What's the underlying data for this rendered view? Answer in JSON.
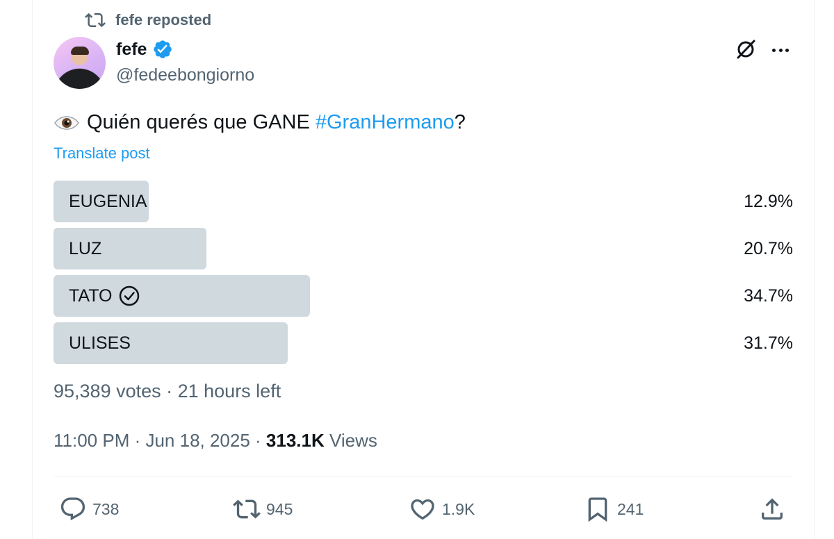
{
  "repost": {
    "text": "fefe reposted",
    "icon": "repost-icon"
  },
  "author": {
    "display_name": "fefe",
    "handle": "@fedeebongiorno",
    "verified": true,
    "verified_color": "#1d9bf0"
  },
  "tweet": {
    "emoji": "👁️",
    "text_before": "Quién querés que GANE ",
    "hashtag": "#GranHermano",
    "text_after": "?",
    "translate_label": "Translate post"
  },
  "poll": {
    "options": [
      {
        "label": "EUGENIA",
        "percent": 12.9,
        "percent_label": "12.9%",
        "selected": false
      },
      {
        "label": "LUZ",
        "percent": 20.7,
        "percent_label": "20.7%",
        "selected": false
      },
      {
        "label": "TATO",
        "percent": 34.7,
        "percent_label": "34.7%",
        "selected": true
      },
      {
        "label": "ULISES",
        "percent": 31.7,
        "percent_label": "31.7%",
        "selected": false
      }
    ],
    "meta": "95,389 votes · 21 hours left",
    "bar_color": "#cfd9de"
  },
  "timestamp": {
    "time_date": "11:00 PM · Jun 18, 2025 · ",
    "views_count": "313.1K",
    "views_label": " Views"
  },
  "actions": {
    "replies": "738",
    "reposts": "945",
    "likes": "1.9K",
    "bookmarks": "241"
  },
  "colors": {
    "accent": "#1d9bf0",
    "secondary_text": "#536471",
    "primary_text": "#0f1419"
  }
}
